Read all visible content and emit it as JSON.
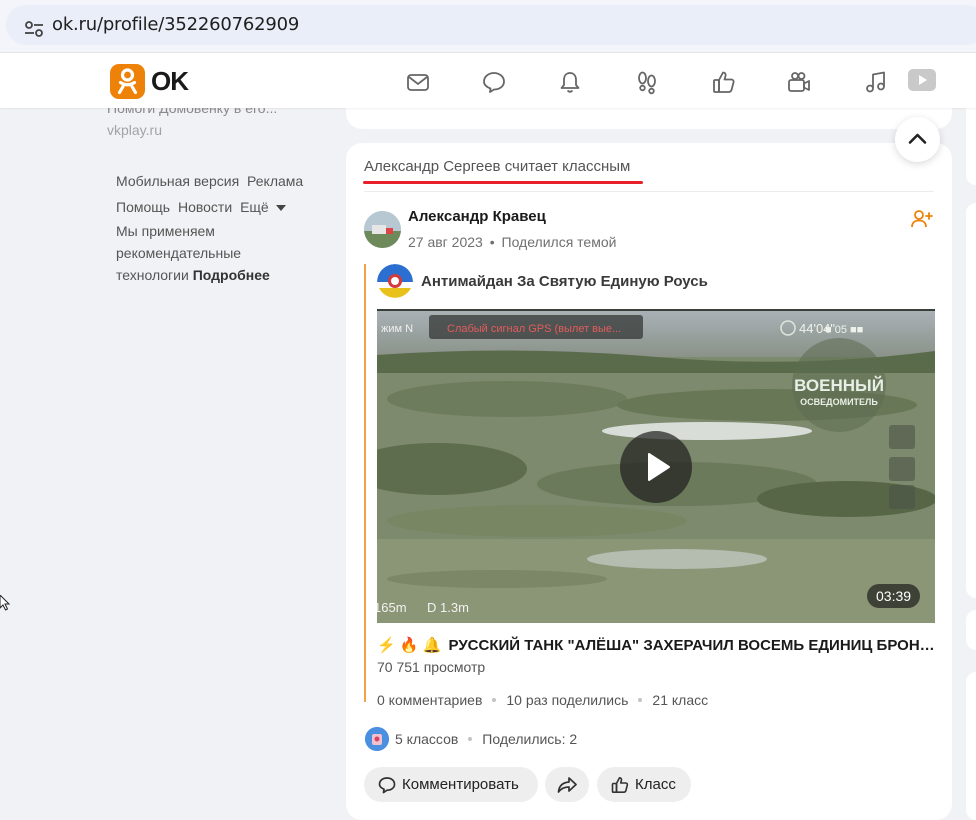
{
  "browser": {
    "url": "ok.ru/profile/352260762909"
  },
  "header": {
    "logo_text": "OK",
    "nav_icons": [
      "mail-icon",
      "chat-icon",
      "bell-icon",
      "guests-icon",
      "like-icon",
      "video-camera-icon",
      "music-icon",
      "video-icon"
    ]
  },
  "sidebar": {
    "promo_text": "Помоги Домовенку в его...",
    "promo_url": "vkplay.ru",
    "links": [
      "Мобильная версия",
      "Реклама",
      "Помощь",
      "Новости",
      "Ещё"
    ],
    "tech_text": "Мы применяем рекомендательные технологии",
    "tech_link": "Подробнее"
  },
  "post": {
    "liker_text": "Александр Сергеев считает классным",
    "author": "Александр Кравец",
    "date": "27 авг 2023",
    "meta_action": "Поделился темой",
    "group_name": "Антимайдан За Святую Единую Роусь",
    "video": {
      "duration": "03:39",
      "overlay_banner": "Слабый сигнал GPS (вылет вые...",
      "watermark_line1": "ВОЕННЫЙ",
      "watermark_line2": "ОСВЕДОМИТЕЛЬ",
      "hud_top_left": "жим N",
      "hud_top_right": "44'04\"",
      "hud_bottom_left_1": "165m",
      "hud_bottom_left_2": "D 1.3m"
    },
    "title_emoji": "⚡ 🔥 🔔",
    "title": "РУССКИЙ ТАНК \"АЛЁША\" ЗАХЕРАЧИЛ ВОСЕМЬ ЕДИНИЦ БРОНЕТЕХНИКИ ВСУ",
    "views": "70 751 просмотр",
    "comments": "0 комментариев",
    "shares": "10 раз поделились",
    "klass": "21 класс",
    "likes_count": "5 классов",
    "shared_count": "Поделились: 2",
    "actions": {
      "comment": "Комментировать",
      "like": "Класс"
    }
  },
  "colors": {
    "brand": "#ee8208",
    "underline": "#e8202a",
    "repost_bar": "#f3a24a"
  }
}
